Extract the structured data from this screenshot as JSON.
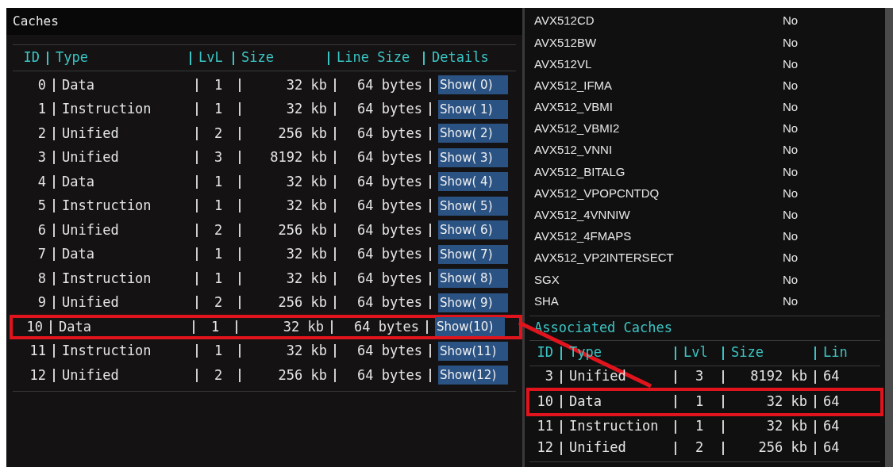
{
  "caches_panel": {
    "title": "Caches",
    "columns": [
      "ID",
      "Type",
      "LvL",
      "Size",
      "Line Size",
      "Details"
    ],
    "rows": [
      {
        "id": "0",
        "type": "Data",
        "level": "1",
        "size": "32 kb",
        "line_size": "64 bytes",
        "details": "Show( 0)",
        "highlighted": false
      },
      {
        "id": "1",
        "type": "Instruction",
        "level": "1",
        "size": "32 kb",
        "line_size": "64 bytes",
        "details": "Show( 1)",
        "highlighted": false
      },
      {
        "id": "2",
        "type": "Unified",
        "level": "2",
        "size": "256 kb",
        "line_size": "64 bytes",
        "details": "Show( 2)",
        "highlighted": false
      },
      {
        "id": "3",
        "type": "Unified",
        "level": "3",
        "size": "8192 kb",
        "line_size": "64 bytes",
        "details": "Show( 3)",
        "highlighted": false
      },
      {
        "id": "4",
        "type": "Data",
        "level": "1",
        "size": "32 kb",
        "line_size": "64 bytes",
        "details": "Show( 4)",
        "highlighted": false
      },
      {
        "id": "5",
        "type": "Instruction",
        "level": "1",
        "size": "32 kb",
        "line_size": "64 bytes",
        "details": "Show( 5)",
        "highlighted": false
      },
      {
        "id": "6",
        "type": "Unified",
        "level": "2",
        "size": "256 kb",
        "line_size": "64 bytes",
        "details": "Show( 6)",
        "highlighted": false
      },
      {
        "id": "7",
        "type": "Data",
        "level": "1",
        "size": "32 kb",
        "line_size": "64 bytes",
        "details": "Show( 7)",
        "highlighted": false
      },
      {
        "id": "8",
        "type": "Instruction",
        "level": "1",
        "size": "32 kb",
        "line_size": "64 bytes",
        "details": "Show( 8)",
        "highlighted": false
      },
      {
        "id": "9",
        "type": "Unified",
        "level": "2",
        "size": "256 kb",
        "line_size": "64 bytes",
        "details": "Show( 9)",
        "highlighted": false
      },
      {
        "id": "10",
        "type": "Data",
        "level": "1",
        "size": "32 kb",
        "line_size": "64 bytes",
        "details": "Show(10)",
        "highlighted": true
      },
      {
        "id": "11",
        "type": "Instruction",
        "level": "1",
        "size": "32 kb",
        "line_size": "64 bytes",
        "details": "Show(11)",
        "highlighted": false
      },
      {
        "id": "12",
        "type": "Unified",
        "level": "2",
        "size": "256 kb",
        "line_size": "64 bytes",
        "details": "Show(12)",
        "highlighted": false
      }
    ]
  },
  "features_panel": {
    "features": [
      {
        "name": "AVX512CD",
        "value": "No"
      },
      {
        "name": "AVX512BW",
        "value": "No"
      },
      {
        "name": "AVX512VL",
        "value": "No"
      },
      {
        "name": "AVX512_IFMA",
        "value": "No"
      },
      {
        "name": "AVX512_VBMI",
        "value": "No"
      },
      {
        "name": "AVX512_VBMI2",
        "value": "No"
      },
      {
        "name": "AVX512_VNNI",
        "value": "No"
      },
      {
        "name": "AVX512_BITALG",
        "value": "No"
      },
      {
        "name": "AVX512_VPOPCNTDQ",
        "value": "No"
      },
      {
        "name": "AVX512_4VNNIW",
        "value": "No"
      },
      {
        "name": "AVX512_4FMAPS",
        "value": "No"
      },
      {
        "name": "AVX512_VP2INTERSECT",
        "value": "No"
      },
      {
        "name": "SGX",
        "value": "No"
      },
      {
        "name": "SHA",
        "value": "No"
      }
    ],
    "associated_caches": {
      "title": "Associated Caches",
      "columns": [
        "ID",
        "Type",
        "Lvl",
        "Size",
        "Lin"
      ],
      "rows": [
        {
          "id": "3",
          "type": "Unified",
          "level": "3",
          "size": "8192 kb",
          "column_5": "64",
          "highlighted": false
        },
        {
          "id": "10",
          "type": "Data",
          "level": "1",
          "size": "32 kb",
          "column_5": "64",
          "highlighted": true
        },
        {
          "id": "11",
          "type": "Instruction",
          "level": "1",
          "size": "32 kb",
          "column_5": "64",
          "highlighted": false
        },
        {
          "id": "12",
          "type": "Unified",
          "level": "2",
          "size": "256 kb",
          "column_5": "64",
          "highlighted": false
        }
      ]
    }
  }
}
